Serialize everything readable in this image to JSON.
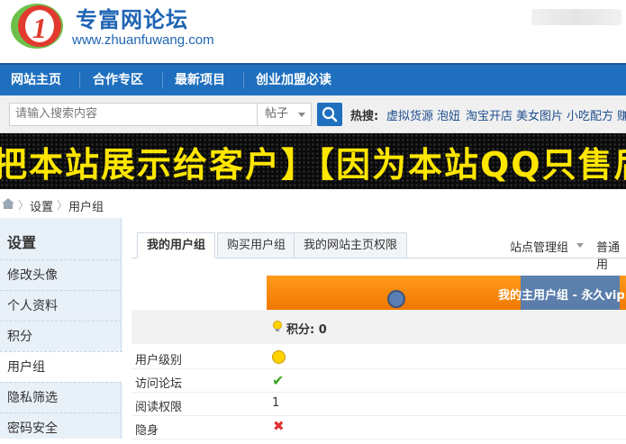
{
  "header": {
    "site_name": "专富网论坛",
    "site_url": "www.zhuanfuwang.com"
  },
  "nav": {
    "items": [
      "网站主页",
      "合作专区",
      "最新项目",
      "创业加盟必读"
    ]
  },
  "search": {
    "placeholder": "请输入搜索内容",
    "type": "帖子",
    "hot_label": "热搜:",
    "hot_links": [
      "虚拟货源",
      "泡妞",
      "淘宝开店",
      "美女图片",
      "小吃配方",
      "赚"
    ]
  },
  "marquee": {
    "text": "把本站展示给客户】【因为本站QQ只售后"
  },
  "breadcrumb": {
    "items": [
      "设置",
      "用户组"
    ]
  },
  "sidebar": {
    "title": "设置",
    "items": [
      "修改头像",
      "个人资料",
      "积分",
      "用户组",
      "隐私筛选",
      "密码安全"
    ],
    "active_index": 3
  },
  "main": {
    "tabs": [
      "我的用户组",
      "购买用户组",
      "我的网站主页权限"
    ],
    "active_tab": 0,
    "right_links": [
      "站点管理组",
      "普通用"
    ],
    "group_banner": "我的主用户组 - 永久vip",
    "points": "积分: 0",
    "rows": [
      {
        "label": "用户级别",
        "value_icon": "smiley-icon"
      },
      {
        "label": "访问论坛",
        "value_icon": "check-icon"
      },
      {
        "label": "阅读权限",
        "value": "1"
      },
      {
        "label": "隐身",
        "value_icon": "cross-icon"
      }
    ]
  },
  "colors": {
    "brand_blue": "#1f6fbe",
    "banner_orange": "#f07800",
    "marquee_yellow": "#ffe600"
  }
}
